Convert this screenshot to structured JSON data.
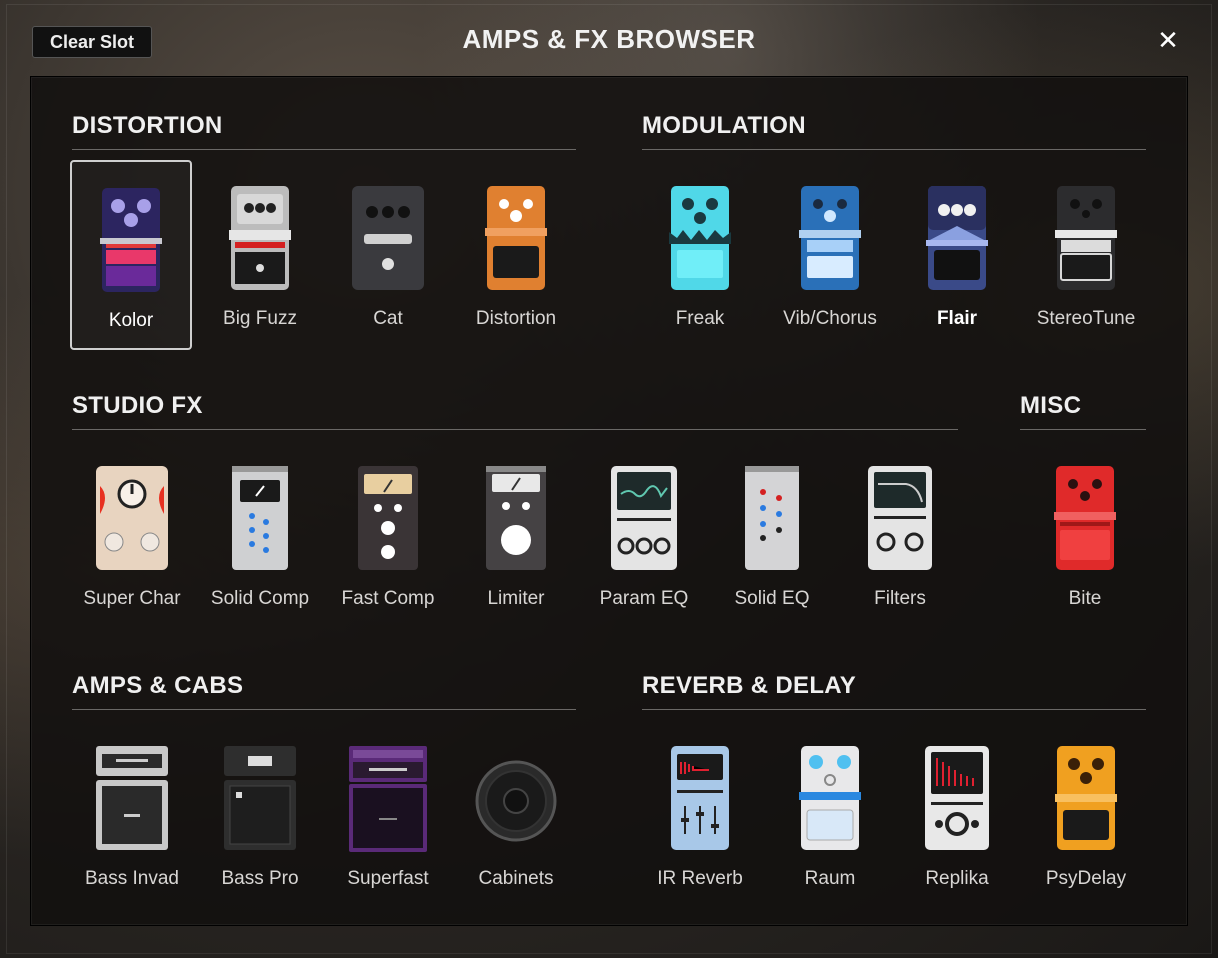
{
  "header": {
    "title": "AMPS & FX BROWSER",
    "clear_slot_label": "Clear Slot",
    "close_label": "✕"
  },
  "sections": {
    "distortion": {
      "title": "DISTORTION",
      "items": [
        {
          "label": "Kolor",
          "icon": "kolor-pedal-icon",
          "selected": true
        },
        {
          "label": "Big Fuzz",
          "icon": "big-fuzz-pedal-icon"
        },
        {
          "label": "Cat",
          "icon": "cat-pedal-icon"
        },
        {
          "label": "Distortion",
          "icon": "distortion-pedal-icon"
        }
      ]
    },
    "modulation": {
      "title": "MODULATION",
      "items": [
        {
          "label": "Freak",
          "icon": "freak-pedal-icon"
        },
        {
          "label": "Vib/Chorus",
          "icon": "vib-chorus-pedal-icon"
        },
        {
          "label": "Flair",
          "icon": "flair-pedal-icon"
        },
        {
          "label": "StereoTune",
          "icon": "stereotune-pedal-icon"
        }
      ]
    },
    "studio_fx": {
      "title": "STUDIO FX",
      "items": [
        {
          "label": "Super Char",
          "icon": "super-char-pedal-icon"
        },
        {
          "label": "Solid Comp",
          "icon": "solid-comp-pedal-icon"
        },
        {
          "label": "Fast Comp",
          "icon": "fast-comp-pedal-icon"
        },
        {
          "label": "Limiter",
          "icon": "limiter-pedal-icon"
        },
        {
          "label": "Param EQ",
          "icon": "param-eq-pedal-icon"
        },
        {
          "label": "Solid EQ",
          "icon": "solid-eq-pedal-icon"
        },
        {
          "label": "Filters",
          "icon": "filters-pedal-icon"
        }
      ]
    },
    "misc": {
      "title": "MISC",
      "items": [
        {
          "label": "Bite",
          "icon": "bite-pedal-icon"
        }
      ]
    },
    "amps_cabs": {
      "title": "AMPS & CABS",
      "items": [
        {
          "label": "Bass Invad",
          "icon": "bass-invad-amp-icon"
        },
        {
          "label": "Bass Pro",
          "icon": "bass-pro-amp-icon"
        },
        {
          "label": "Superfast",
          "icon": "superfast-amp-icon"
        },
        {
          "label": "Cabinets",
          "icon": "cabinets-speaker-icon"
        }
      ]
    },
    "reverb_delay": {
      "title": "REVERB & DELAY",
      "items": [
        {
          "label": "IR Reverb",
          "icon": "ir-reverb-pedal-icon"
        },
        {
          "label": "Raum",
          "icon": "raum-pedal-icon"
        },
        {
          "label": "Replika",
          "icon": "replika-pedal-icon"
        },
        {
          "label": "PsyDelay",
          "icon": "psydelay-pedal-icon"
        }
      ]
    }
  }
}
